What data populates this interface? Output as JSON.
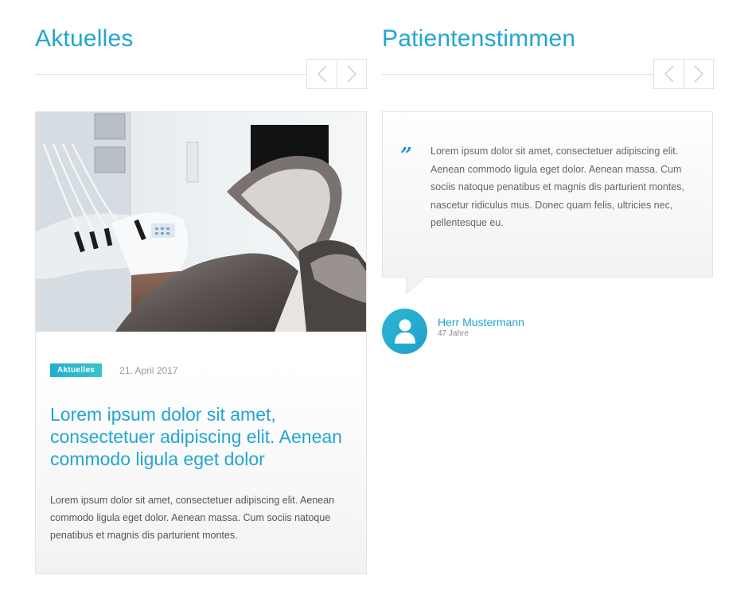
{
  "news": {
    "section_title": "Aktuelles",
    "prev_icon": "chevron-left-icon",
    "next_icon": "chevron-right-icon",
    "card": {
      "image_alt": "dental treatment room",
      "badge": "Aktuelles",
      "date": "21. April 2017",
      "headline": "Lorem ipsum dolor sit amet, consectetuer adipiscing elit. Aenean commodo ligula eget dolor",
      "text": "Lorem ipsum dolor sit amet, consectetuer adipiscing elit. Aenean commodo ligula eget dolor. Aenean massa. Cum sociis natoque penatibus et magnis dis parturient montes."
    }
  },
  "testimonials": {
    "section_title": "Patientenstimmen",
    "prev_icon": "chevron-left-icon",
    "next_icon": "chevron-right-icon",
    "quote_mark": "”",
    "quote": "Lorem ipsum dolor sit amet, consectetuer adipiscing elit. Aenean commodo ligula eget dolor. Aenean massa. Cum sociis natoque penatibus et magnis dis parturient montes, nascetur ridiculus mus. Donec quam felis, ultricies nec, pellentesque eu.",
    "author_name": "Herr Mustermann",
    "author_age": "47 Jahre",
    "avatar_icon": "user-icon"
  },
  "colors": {
    "accent": "#21a6cf",
    "badge_gradient_start": "#1fb0cf",
    "badge_gradient_end": "#39c3c7",
    "border": "#e3e3e3"
  }
}
